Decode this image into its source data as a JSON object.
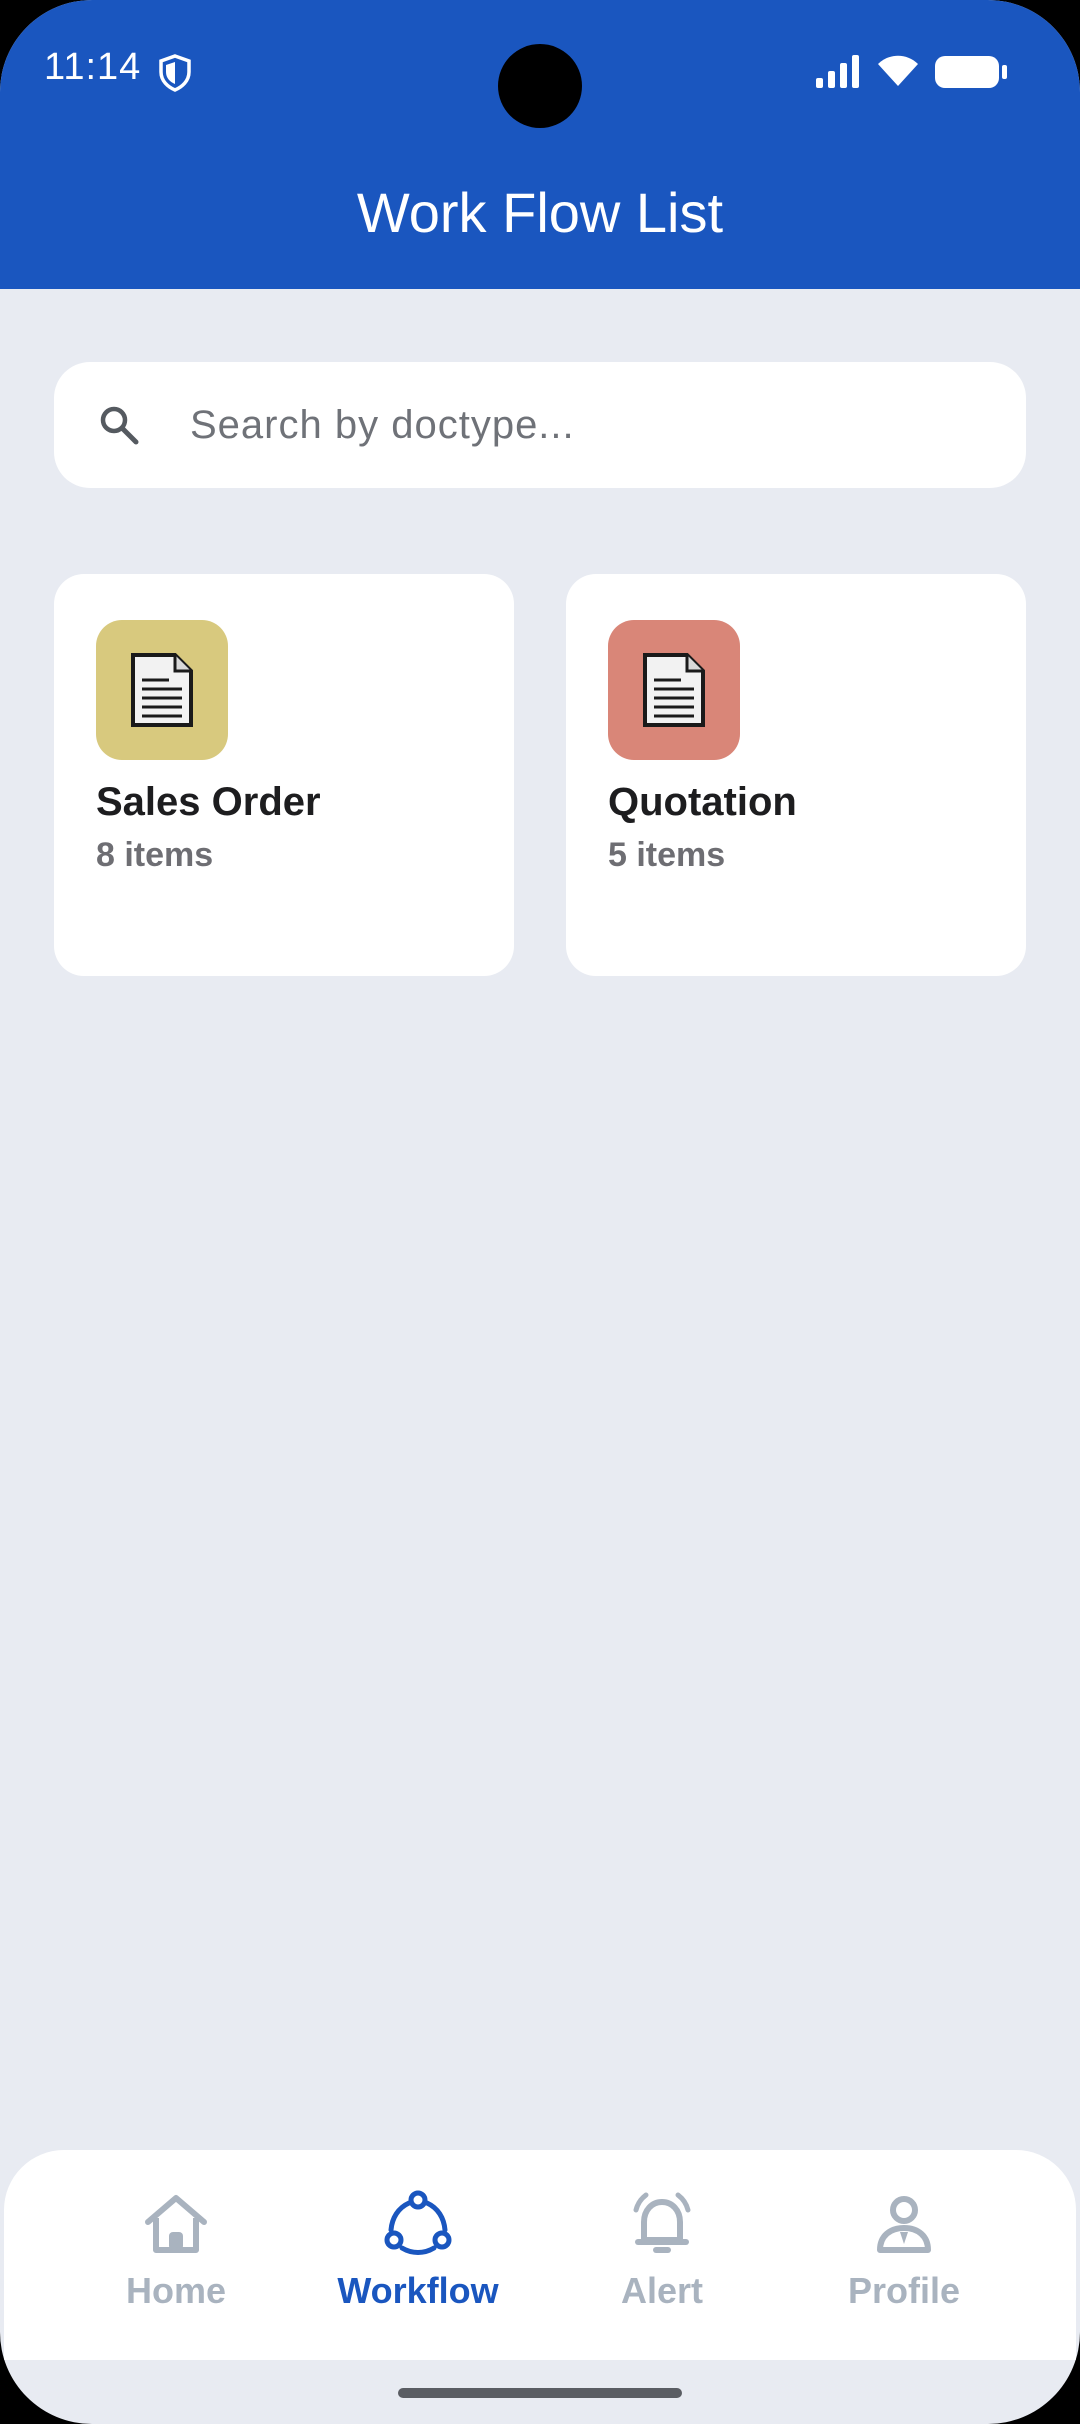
{
  "status_bar": {
    "time": "11:14",
    "icons": [
      "shield-icon",
      "signal-icon",
      "wifi-icon",
      "battery-icon"
    ]
  },
  "header": {
    "title": "Work Flow List",
    "color": "#1a56bf"
  },
  "search": {
    "placeholder": "Search by doctype...",
    "value": "",
    "icon": "search-icon"
  },
  "workflows": [
    {
      "name": "Sales Order",
      "count": "8 items",
      "icon": "document-icon",
      "icon_bg": "#d8c97e"
    },
    {
      "name": "Quotation",
      "count": "5 items",
      "icon": "document-icon",
      "icon_bg": "#d98678"
    }
  ],
  "bottom_nav": {
    "items": [
      {
        "label": "Home",
        "icon": "home-icon",
        "active": false
      },
      {
        "label": "Workflow",
        "icon": "workflow-icon",
        "active": true
      },
      {
        "label": "Alert",
        "icon": "bell-icon",
        "active": false
      },
      {
        "label": "Profile",
        "icon": "profile-icon",
        "active": false
      }
    ],
    "active_color": "#1a56bf",
    "inactive_color": "#a9b3bf"
  }
}
